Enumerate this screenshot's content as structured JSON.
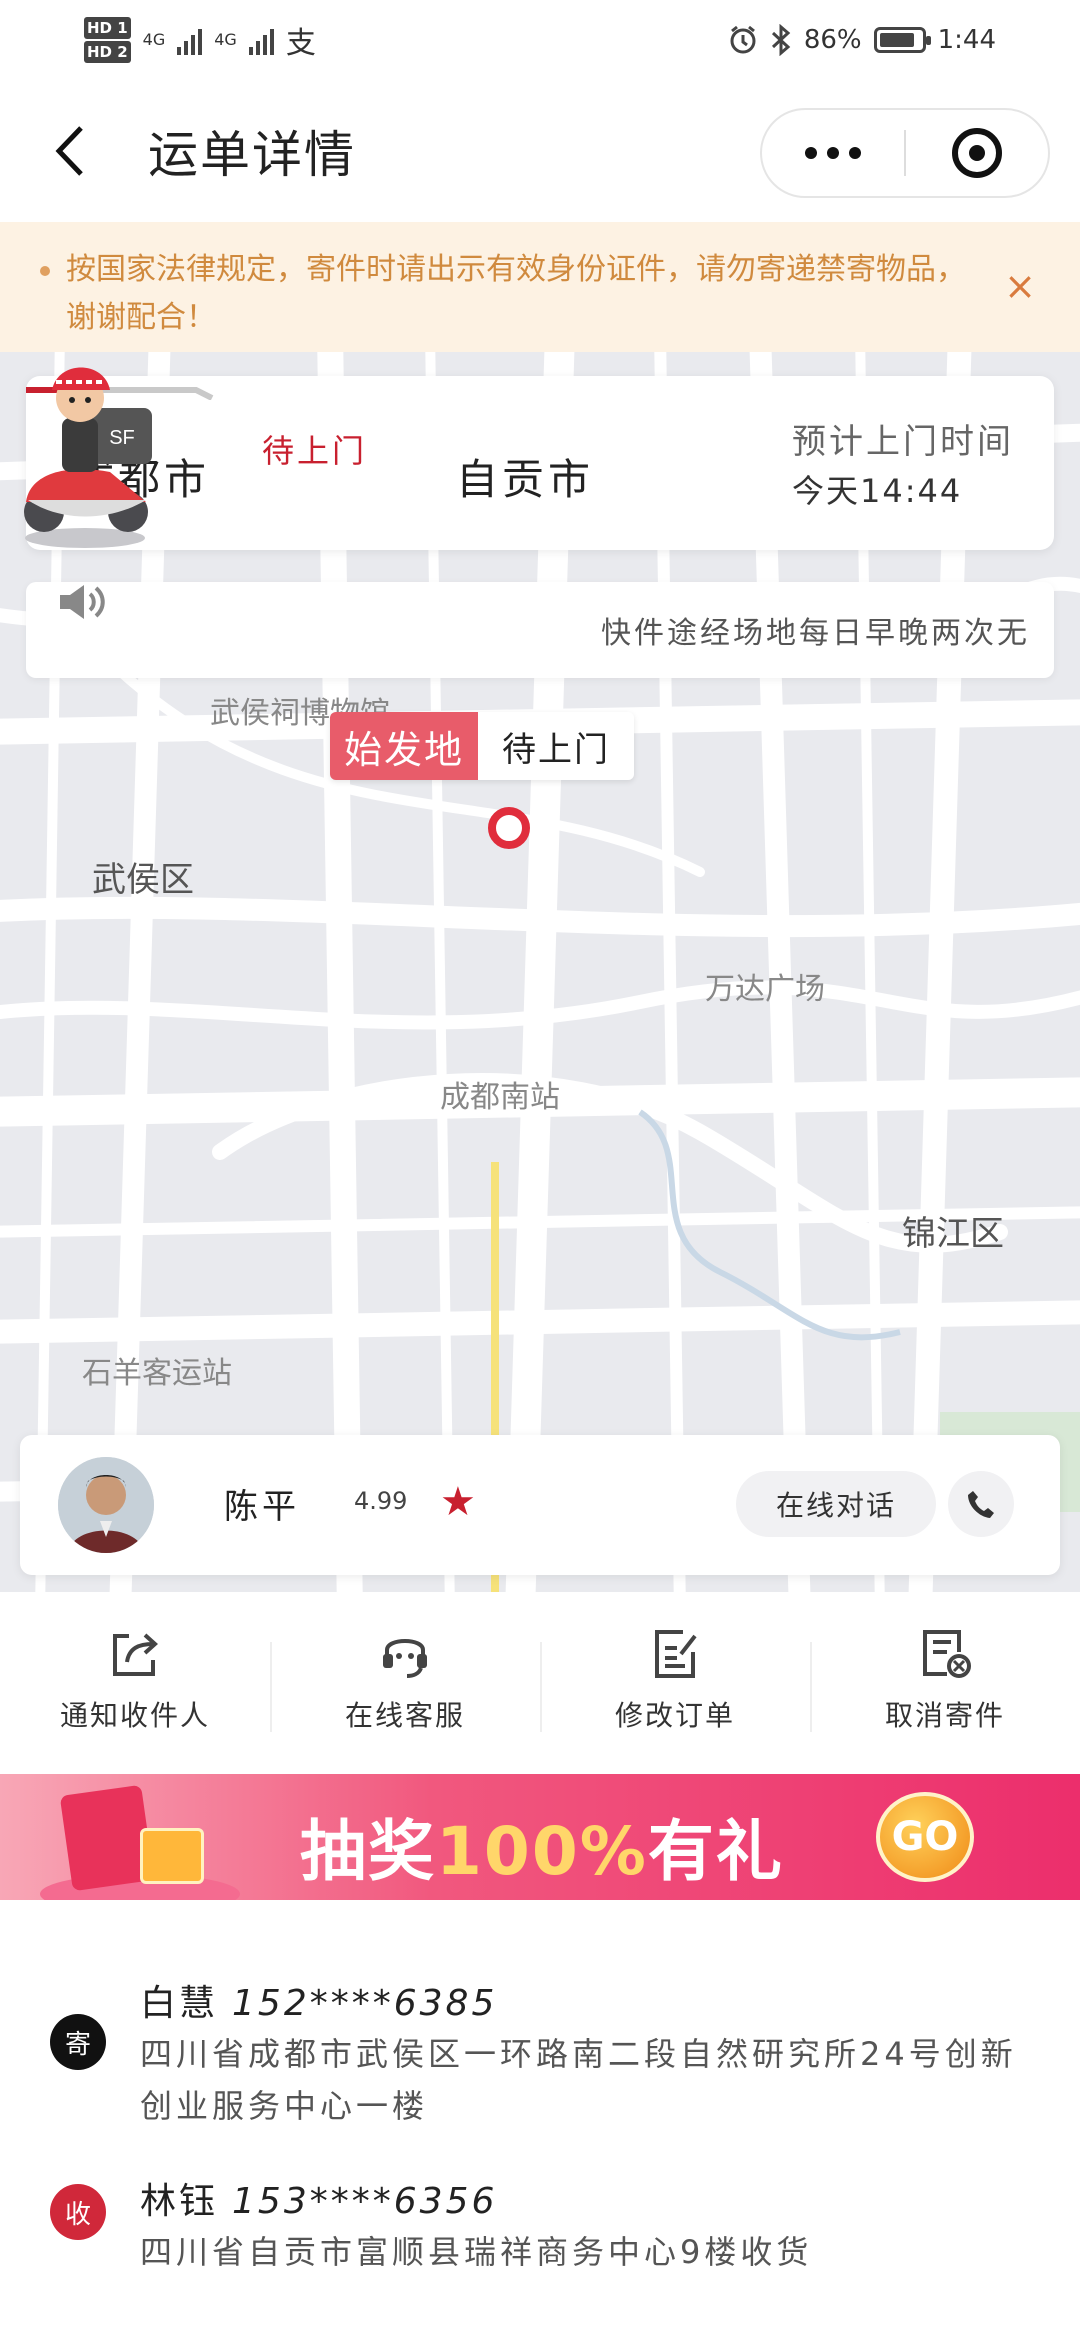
{
  "status_bar": {
    "hd1": "HD 1",
    "hd2": "HD 2",
    "net1": "4G",
    "net2": "4G",
    "alipay": "支",
    "battery": "86%",
    "battery_level": 0.86,
    "time": "1:44"
  },
  "header": {
    "title": "运单详情"
  },
  "notice": {
    "text": "按国家法律规定，寄件时请出示有效身份证件，请勿寄递禁寄物品，谢谢配合！",
    "close": "×"
  },
  "route": {
    "from": "成都市",
    "status": "待上门",
    "to": "自贡市",
    "eta_label": "预计上门时间",
    "eta_time": "今天14:44"
  },
  "marquee": {
    "text": "快件途经场地每日早晚两次无"
  },
  "map": {
    "labels": [
      "武侯祠博物馆",
      "武侯区",
      "万达广场",
      "成都南站",
      "锦江区",
      "石羊客运站"
    ],
    "origin_tag": "始发地",
    "origin_status": "待上门"
  },
  "courier": {
    "name": "陈平",
    "rating": "4.99",
    "star": "★",
    "chat_label": "在线对话"
  },
  "actions": [
    {
      "label": "通知收件人",
      "icon": "share-icon"
    },
    {
      "label": "在线客服",
      "icon": "headset-icon"
    },
    {
      "label": "修改订单",
      "icon": "edit-order-icon"
    },
    {
      "label": "取消寄件",
      "icon": "cancel-order-icon"
    }
  ],
  "banner": {
    "text_a": "抽奖",
    "text_b": "100%",
    "text_c": "有礼",
    "go": "GO"
  },
  "sender": {
    "badge": "寄",
    "name": "白慧",
    "phone": "152****6385",
    "address": "四川省成都市武侯区一环路南二段自然研究所24号创新创业服务中心一楼"
  },
  "receiver": {
    "badge": "收",
    "name": "林钰",
    "phone": "153****6356",
    "address": "四川省自贡市富顺县瑞祥商务中心9楼收货"
  }
}
